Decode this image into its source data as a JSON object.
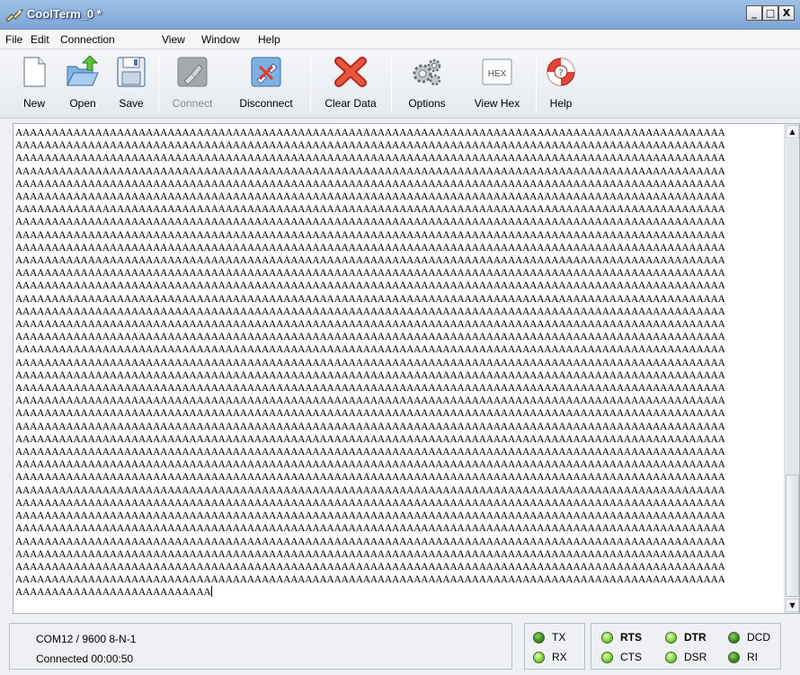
{
  "window": {
    "title": "CoolTerm_0 *",
    "controls": {
      "minimize": "_",
      "maximize": "□",
      "close": "X"
    }
  },
  "menu": {
    "items": [
      "File",
      "Edit",
      "Connection",
      "View",
      "Window",
      "Help"
    ]
  },
  "toolbar": {
    "buttons": [
      {
        "label": "New",
        "icon": "new-document-icon",
        "enabled": true
      },
      {
        "label": "Open",
        "icon": "open-folder-icon",
        "enabled": true
      },
      {
        "label": "Save",
        "icon": "save-disk-icon",
        "enabled": true
      },
      {
        "label": "Connect",
        "icon": "connect-plug-icon",
        "enabled": false
      },
      {
        "label": "Disconnect",
        "icon": "disconnect-plug-icon",
        "enabled": true
      },
      {
        "label": "Clear Data",
        "icon": "clear-x-icon",
        "enabled": true
      },
      {
        "label": "Options",
        "icon": "gears-icon",
        "enabled": true
      },
      {
        "label": "View Hex",
        "icon": "hex-icon",
        "enabled": true,
        "icon_text": "HEX"
      },
      {
        "label": "Help",
        "icon": "lifebuoy-icon",
        "enabled": true
      }
    ]
  },
  "terminal": {
    "full_line": "AAAAAAAAAAAAAAAAAAAAAAAAAAAAAAAAAAAAAAAAAAAAAAAAAAAAAAAAAAAAAAAAAAAAAAAAAAAAAAAAAAAAAAAAAAAAAAAAAA",
    "full_line_count": 36,
    "last_line": "AAAAAAAAAAAAAAAAAAAAAAAAAAA",
    "scroll_up_arrow": "▲",
    "scroll_down_arrow": "▼"
  },
  "status": {
    "port_settings": "COM12 / 9600 8-N-1",
    "connection": "Connected 00:00:50",
    "indicators": {
      "tx": {
        "label": "TX",
        "state": "dark"
      },
      "rx": {
        "label": "RX",
        "state": "bright"
      },
      "rts": {
        "label": "RTS",
        "state": "bright"
      },
      "cts": {
        "label": "CTS",
        "state": "bright"
      },
      "dtr": {
        "label": "DTR",
        "state": "bright"
      },
      "dsr": {
        "label": "DSR",
        "state": "bright"
      },
      "dcd": {
        "label": "DCD",
        "state": "dark"
      },
      "ri": {
        "label": "RI",
        "state": "dark"
      }
    }
  }
}
